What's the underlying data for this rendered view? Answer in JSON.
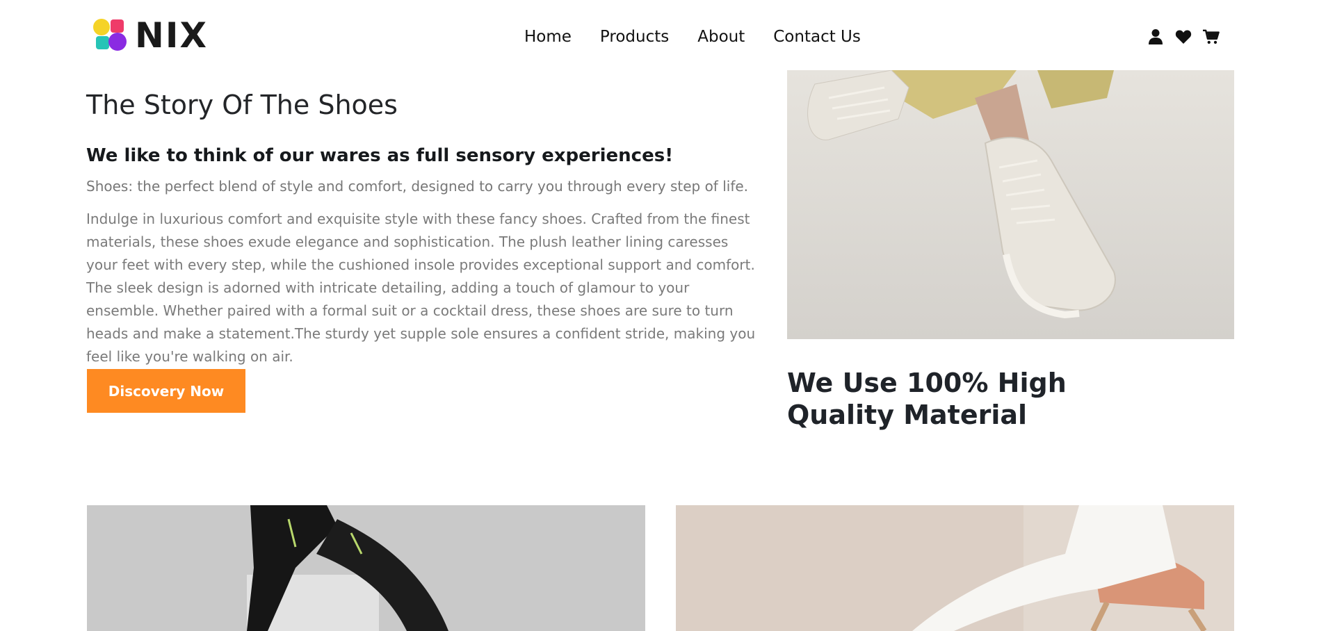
{
  "brand": {
    "name": "NIX"
  },
  "nav": {
    "items": [
      {
        "label": "Home"
      },
      {
        "label": "Products"
      },
      {
        "label": "About"
      },
      {
        "label": "Contact Us"
      }
    ]
  },
  "header_icons": [
    "user-icon",
    "heart-icon",
    "cart-icon"
  ],
  "story": {
    "title": "The Story Of The Shoes",
    "subtitle": "We like to think of our wares as full sensory experiences!",
    "lead": "Shoes: the perfect blend of style and comfort, designed to carry you through every step of life.",
    "body": "Indulge in luxurious comfort and exquisite style with these fancy shoes. Crafted from the finest materials, these shoes exude elegance and sophistication. The plush leather lining caresses your feet with every step, while the cushioned insole provides exceptional support and comfort. The sleek design is adorned with intricate detailing, adding a touch of glamour to your ensemble. Whether paired with a formal suit or a cocktail dress, these shoes are sure to turn heads and make a statement.The sturdy yet supple sole ensures a confident stride, making you feel like you're walking on air.",
    "button_label": "Discovery Now"
  },
  "quality": {
    "heading": "We Use 100% High Quality Material"
  },
  "colors": {
    "accent": "#fe8a22",
    "text_dark": "#1f2329",
    "text_muted": "#7a7a7a"
  }
}
